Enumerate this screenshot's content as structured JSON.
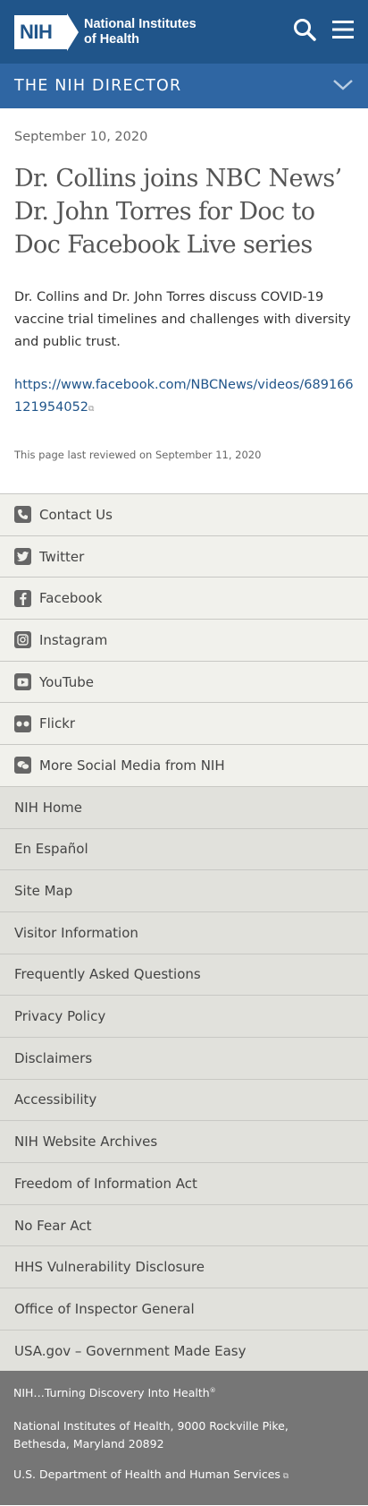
{
  "header": {
    "logo_mark": "NIH",
    "logo_line1": "National Institutes",
    "logo_line2": "of Health",
    "search_icon": "search-icon",
    "menu_icon": "hamburger-menu-icon"
  },
  "section_bar": {
    "label": "THE NIH DIRECTOR",
    "toggle_icon": "chevron-down-icon"
  },
  "article": {
    "date": "September 10, 2020",
    "title": "Dr. Collins joins NBC News’ Dr. John Torres for Doc to Doc Facebook Live series",
    "description": "Dr. Collins and Dr. John Torres discuss COVID-19 vaccine trial timelines and challenges with diversity and public trust.",
    "link": "https://www.facebook.com/NBCNews/videos/689166121954052",
    "last_reviewed": "This page last reviewed on September 11, 2020"
  },
  "social": [
    {
      "label": "Contact Us",
      "icon": "phone-icon"
    },
    {
      "label": "Twitter",
      "icon": "twitter-icon"
    },
    {
      "label": "Facebook",
      "icon": "facebook-icon"
    },
    {
      "label": "Instagram",
      "icon": "instagram-icon"
    },
    {
      "label": "YouTube",
      "icon": "youtube-icon"
    },
    {
      "label": "Flickr",
      "icon": "flickr-icon"
    },
    {
      "label": "More Social Media from NIH",
      "icon": "social-media-icon"
    }
  ],
  "footer_links": [
    "NIH Home",
    "En Español",
    "Site Map",
    "Visitor Information",
    "Frequently Asked Questions",
    "Privacy Policy",
    "Disclaimers",
    "Accessibility",
    "NIH Website Archives",
    "Freedom of Information Act",
    "No Fear Act",
    "HHS Vulnerability Disclosure",
    "Office of Inspector General",
    "USA.gov – Government Made Easy"
  ],
  "bottom": {
    "tagline": "NIH…Turning Discovery Into Health",
    "tagline_mark": "®",
    "address_line1": "National Institutes of Health, 9000 Rockville Pike,",
    "address_line2": "Bethesda, Maryland 20892",
    "hhs": "U.S. Department of Health and Human Services"
  },
  "colors": {
    "header_bg": "#20558a",
    "section_bar_bg": "#2f66a3",
    "link": "#20558a",
    "social_bg": "#f1f1ec",
    "links_bg": "#e1e1dc",
    "bottom_bg": "#767676"
  }
}
